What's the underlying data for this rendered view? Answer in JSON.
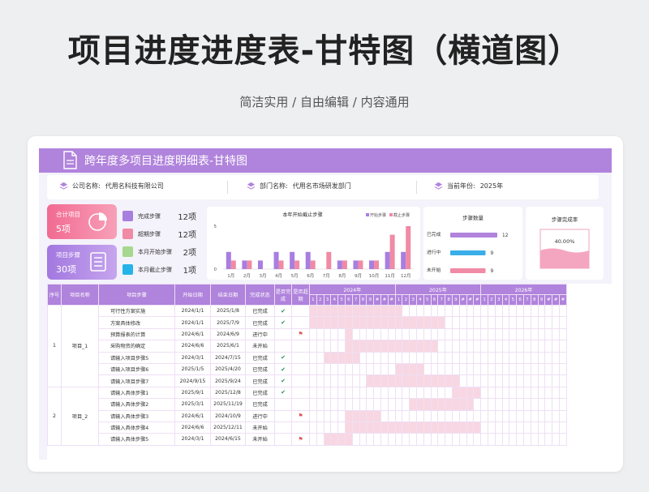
{
  "header": {
    "title": "项目进度进度表-甘特图（横道图）",
    "subtitle": "简洁实用 / 自由编辑 / 内容通用"
  },
  "sheet": {
    "banner_title": "跨年度多项目进度明细表-甘特图",
    "info": {
      "company_key": "公司名称:",
      "company_val": "代用名科技有限公司",
      "dept_key": "部门名称:",
      "dept_val": "代用名市场研发部门",
      "year_key": "当前年份:",
      "year_val": "2025年"
    },
    "tiles": {
      "total_label": "合计项目",
      "total_value": "5项",
      "steps_label": "项目步骤",
      "steps_value": "30项"
    },
    "legend": [
      {
        "label": "完成步骤",
        "value": "12项",
        "color": "#a87ee0"
      },
      {
        "label": "超期步骤",
        "value": "12项",
        "color": "#f08aa5"
      },
      {
        "label": "本月开始步骤",
        "value": "2项",
        "color": "#a7d88f"
      },
      {
        "label": "本月截止步骤",
        "value": "1项",
        "color": "#25b3e8"
      }
    ],
    "colors": {
      "accent": "#b083dc",
      "start": "#a87ee0",
      "end": "#f08aa5",
      "gantt": "#f8d7e2"
    },
    "gauge": {
      "title": "步骤完成率",
      "value_label": "40.00%",
      "fraction": 0.4
    },
    "status_chart": {
      "title": "步骤数量",
      "items": [
        {
          "label": "已完成",
          "value": 12,
          "value_label": "12",
          "color": "#b083dc"
        },
        {
          "label": "进行中",
          "value": 9,
          "value_label": "9",
          "color": "#3aaee8"
        },
        {
          "label": "未开始",
          "value": 9,
          "value_label": "9",
          "color": "#f08aa5"
        }
      ],
      "max": 12
    },
    "table": {
      "headers": {
        "seq": "序号",
        "name": "项目名称",
        "step": "项目步骤",
        "start": "开始日期",
        "end": "结束日期",
        "status": "完成状态",
        "done": "是否完成",
        "overdue": "是否超期"
      },
      "years": [
        "2024年",
        "2025年",
        "2026年"
      ],
      "months": [
        "1",
        "2",
        "3",
        "4",
        "5",
        "6",
        "7",
        "8",
        "9",
        "#",
        "#",
        "#",
        "1",
        "2",
        "3",
        "4",
        "5",
        "6",
        "7",
        "8",
        "9",
        "#",
        "#",
        "#",
        "1",
        "2",
        "3",
        "4",
        "5",
        "6",
        "7",
        "8",
        "9",
        "#",
        "#",
        "#"
      ],
      "rows": [
        {
          "seq": "1",
          "project": "项目_1",
          "step": "可行性方案实施",
          "start": "2024/1/1",
          "end": "2025/1/8",
          "status": "已完成",
          "done": true,
          "overdue": false,
          "g0": 0,
          "g1": 12
        },
        {
          "seq": "",
          "project": "",
          "step": "方案具体修改",
          "start": "2024/1/1",
          "end": "2025/7/9",
          "status": "已完成",
          "done": true,
          "overdue": false,
          "g0": 0,
          "g1": 18
        },
        {
          "seq": "",
          "project": "",
          "step": "预算报表的计算",
          "start": "2024/6/1",
          "end": "2024/6/9",
          "status": "进行中",
          "done": false,
          "overdue": true,
          "g0": 5,
          "g1": 5
        },
        {
          "seq": "",
          "project": "",
          "step": "采购物资的确定",
          "start": "2024/6/6",
          "end": "2025/6/1",
          "status": "未开始",
          "done": false,
          "overdue": false,
          "g0": 5,
          "g1": 17
        },
        {
          "seq": "",
          "project": "",
          "step": "请输入项目步骤5",
          "start": "2024/3/1",
          "end": "2024/7/15",
          "status": "已完成",
          "done": true,
          "overdue": false,
          "g0": 2,
          "g1": 6
        },
        {
          "seq": "",
          "project": "",
          "step": "请输入项目步骤6",
          "start": "2025/1/5",
          "end": "2025/4/20",
          "status": "已完成",
          "done": true,
          "overdue": false,
          "g0": 12,
          "g1": 15
        },
        {
          "seq": "",
          "project": "",
          "step": "请输入项目步骤7",
          "start": "2024/9/15",
          "end": "2025/9/24",
          "status": "已完成",
          "done": true,
          "overdue": false,
          "g0": 8,
          "g1": 20
        },
        {
          "seq": "2",
          "project": "项目_2",
          "step": "请输入具体步骤1",
          "start": "2025/9/1",
          "end": "2025/12/8",
          "status": "已完成",
          "done": true,
          "overdue": false,
          "g0": 20,
          "g1": 23
        },
        {
          "seq": "",
          "project": "",
          "step": "请输入具体步骤2",
          "start": "2025/3/1",
          "end": "2025/11/19",
          "status": "已完成",
          "done": false,
          "overdue": false,
          "g0": 14,
          "g1": 22
        },
        {
          "seq": "",
          "project": "",
          "step": "请输入具体步骤3",
          "start": "2024/6/1",
          "end": "2024/10/9",
          "status": "进行中",
          "done": false,
          "overdue": true,
          "g0": 5,
          "g1": 9
        },
        {
          "seq": "",
          "project": "",
          "step": "请输入具体步骤4",
          "start": "2024/6/6",
          "end": "2025/12/11",
          "status": "未开始",
          "done": false,
          "overdue": false,
          "g0": 5,
          "g1": 23
        },
        {
          "seq": "",
          "project": "",
          "step": "请输入具体步骤5",
          "start": "2024/3/1",
          "end": "2024/6/15",
          "status": "未开始",
          "done": false,
          "overdue": true,
          "g0": 2,
          "g1": 5
        }
      ]
    }
  },
  "chart_data": {
    "type": "bar",
    "title": "本年开始截止步骤",
    "categories": [
      "1月",
      "2月",
      "3月",
      "4月",
      "5月",
      "6月",
      "7月",
      "8月",
      "9月",
      "10月",
      "11月",
      "12月"
    ],
    "series": [
      {
        "name": "开始步骤",
        "values": [
          2,
          1,
          1,
          2,
          2,
          2,
          0,
          1,
          1,
          1,
          2,
          2
        ]
      },
      {
        "name": "截止步骤",
        "values": [
          1,
          1,
          0,
          1,
          1,
          1,
          2,
          1,
          1,
          1,
          4,
          5
        ]
      }
    ],
    "yticks": [
      "0",
      "5"
    ],
    "ylim": [
      0,
      5
    ]
  }
}
